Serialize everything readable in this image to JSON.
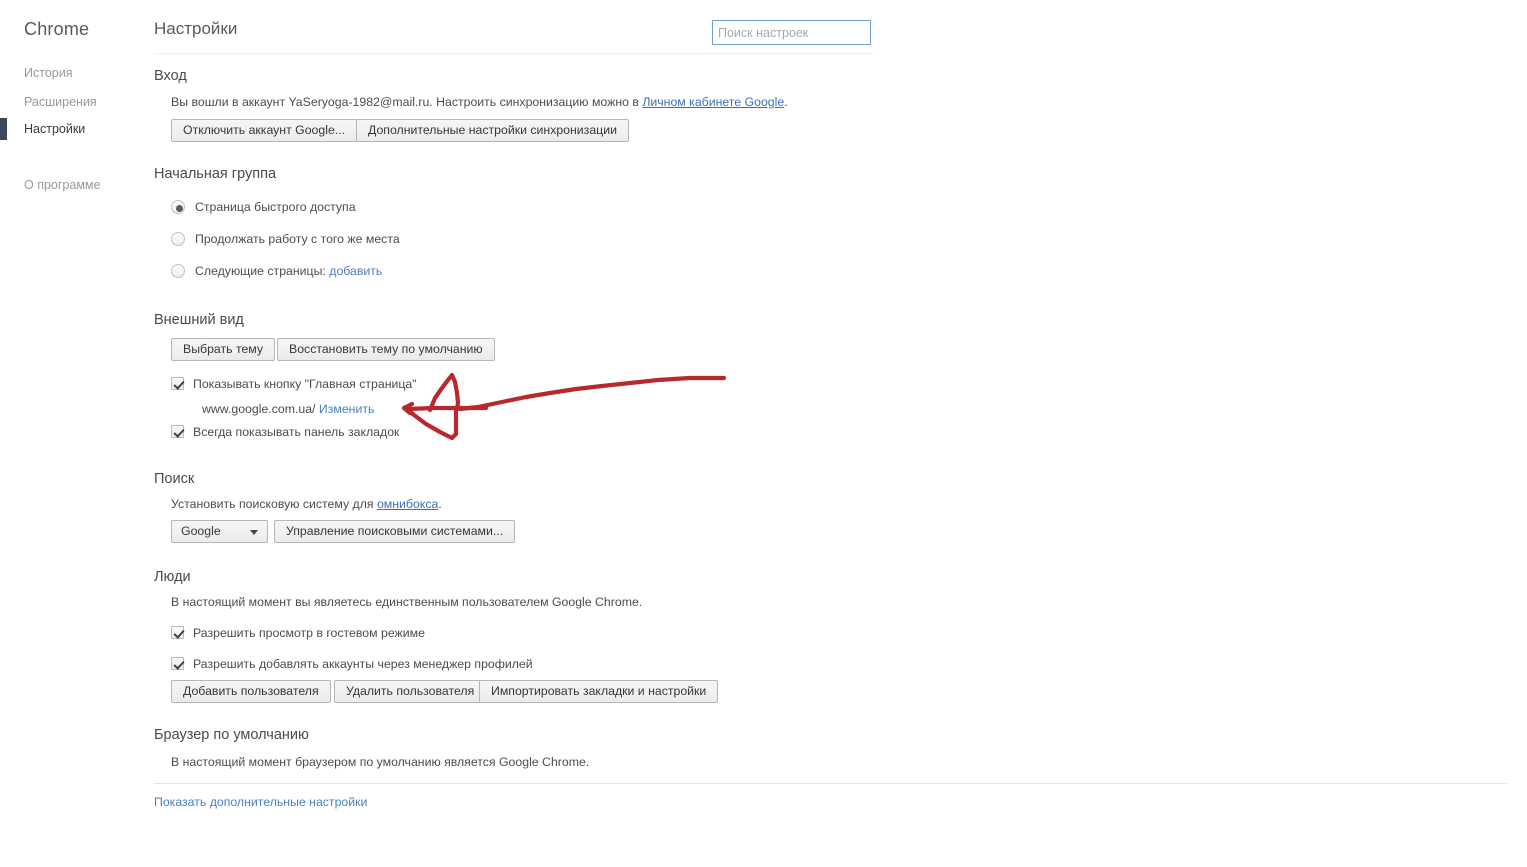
{
  "sidebar": {
    "brand": "Chrome",
    "items": [
      {
        "label": "История",
        "active": false
      },
      {
        "label": "Расширения",
        "active": false
      },
      {
        "label": "Настройки",
        "active": true
      },
      {
        "label": "О программе",
        "active": false
      }
    ]
  },
  "header": {
    "title": "Настройки",
    "search_placeholder": "Поиск настроек",
    "search_value": ""
  },
  "signin": {
    "title": "Вход",
    "description_before": "Вы вошли в аккаунт YaSeryoga-1982@mail.ru. Настроить синхронизацию можно в ",
    "description_link": "Личном кабинете Google",
    "description_after": ".",
    "account_email": "YaSeryoga-1982@mail.ru",
    "disconnect_button": "Отключить аккаунт Google...",
    "advanced_sync_button": "Дополнительные настройки синхронизации"
  },
  "startup": {
    "title": "Начальная группа",
    "options": [
      {
        "label": "Страница быстрого доступа",
        "checked": true,
        "link": ""
      },
      {
        "label": "Продолжать работу с того же места",
        "checked": false,
        "link": ""
      },
      {
        "label": "Следующие страницы:",
        "checked": false,
        "link": "добавить"
      }
    ]
  },
  "appearance": {
    "title": "Внешний вид",
    "choose_theme_button": "Выбрать тему",
    "reset_theme_button": "Восстановить тему по умолчанию",
    "show_home_label": "Показывать кнопку \"Главная страница\"",
    "show_home_checked": true,
    "homepage_url": "www.google.com.ua/",
    "homepage_change_link": "Изменить",
    "always_bookmarks_label": "Всегда показывать панель закладок",
    "always_bookmarks_checked": true
  },
  "search": {
    "title": "Поиск",
    "description_before": "Установить поисковую систему для ",
    "description_link": "омнибокса",
    "description_after": ".",
    "engine_selected": "Google",
    "manage_button": "Управление поисковыми системами..."
  },
  "people": {
    "title": "Люди",
    "description": "В настоящий момент вы являетесь единственным пользователем Google Chrome.",
    "guest_label": "Разрешить просмотр в гостевом режиме",
    "guest_checked": true,
    "add_accounts_label": "Разрешить добавлять аккаунты через менеджер профилей",
    "add_accounts_checked": true,
    "add_user_button": "Добавить пользователя",
    "remove_user_button": "Удалить пользователя",
    "import_button": "Импортировать закладки и настройки"
  },
  "default_browser": {
    "title": "Браузер по умолчанию",
    "description": "В настоящий момент браузером по умолчанию является Google Chrome."
  },
  "footer": {
    "advanced_link": "Показать дополнительные настройки"
  },
  "annotation": {
    "kind": "hand-drawn-red-arrow",
    "color": "#b8282d",
    "points_at": "homepage-url-row"
  },
  "colors": {
    "accent_active_nav": "#3c4858",
    "link": "#3b6fb5",
    "annotation_red": "#b8282d",
    "focus_border": "#6aa2d8"
  }
}
